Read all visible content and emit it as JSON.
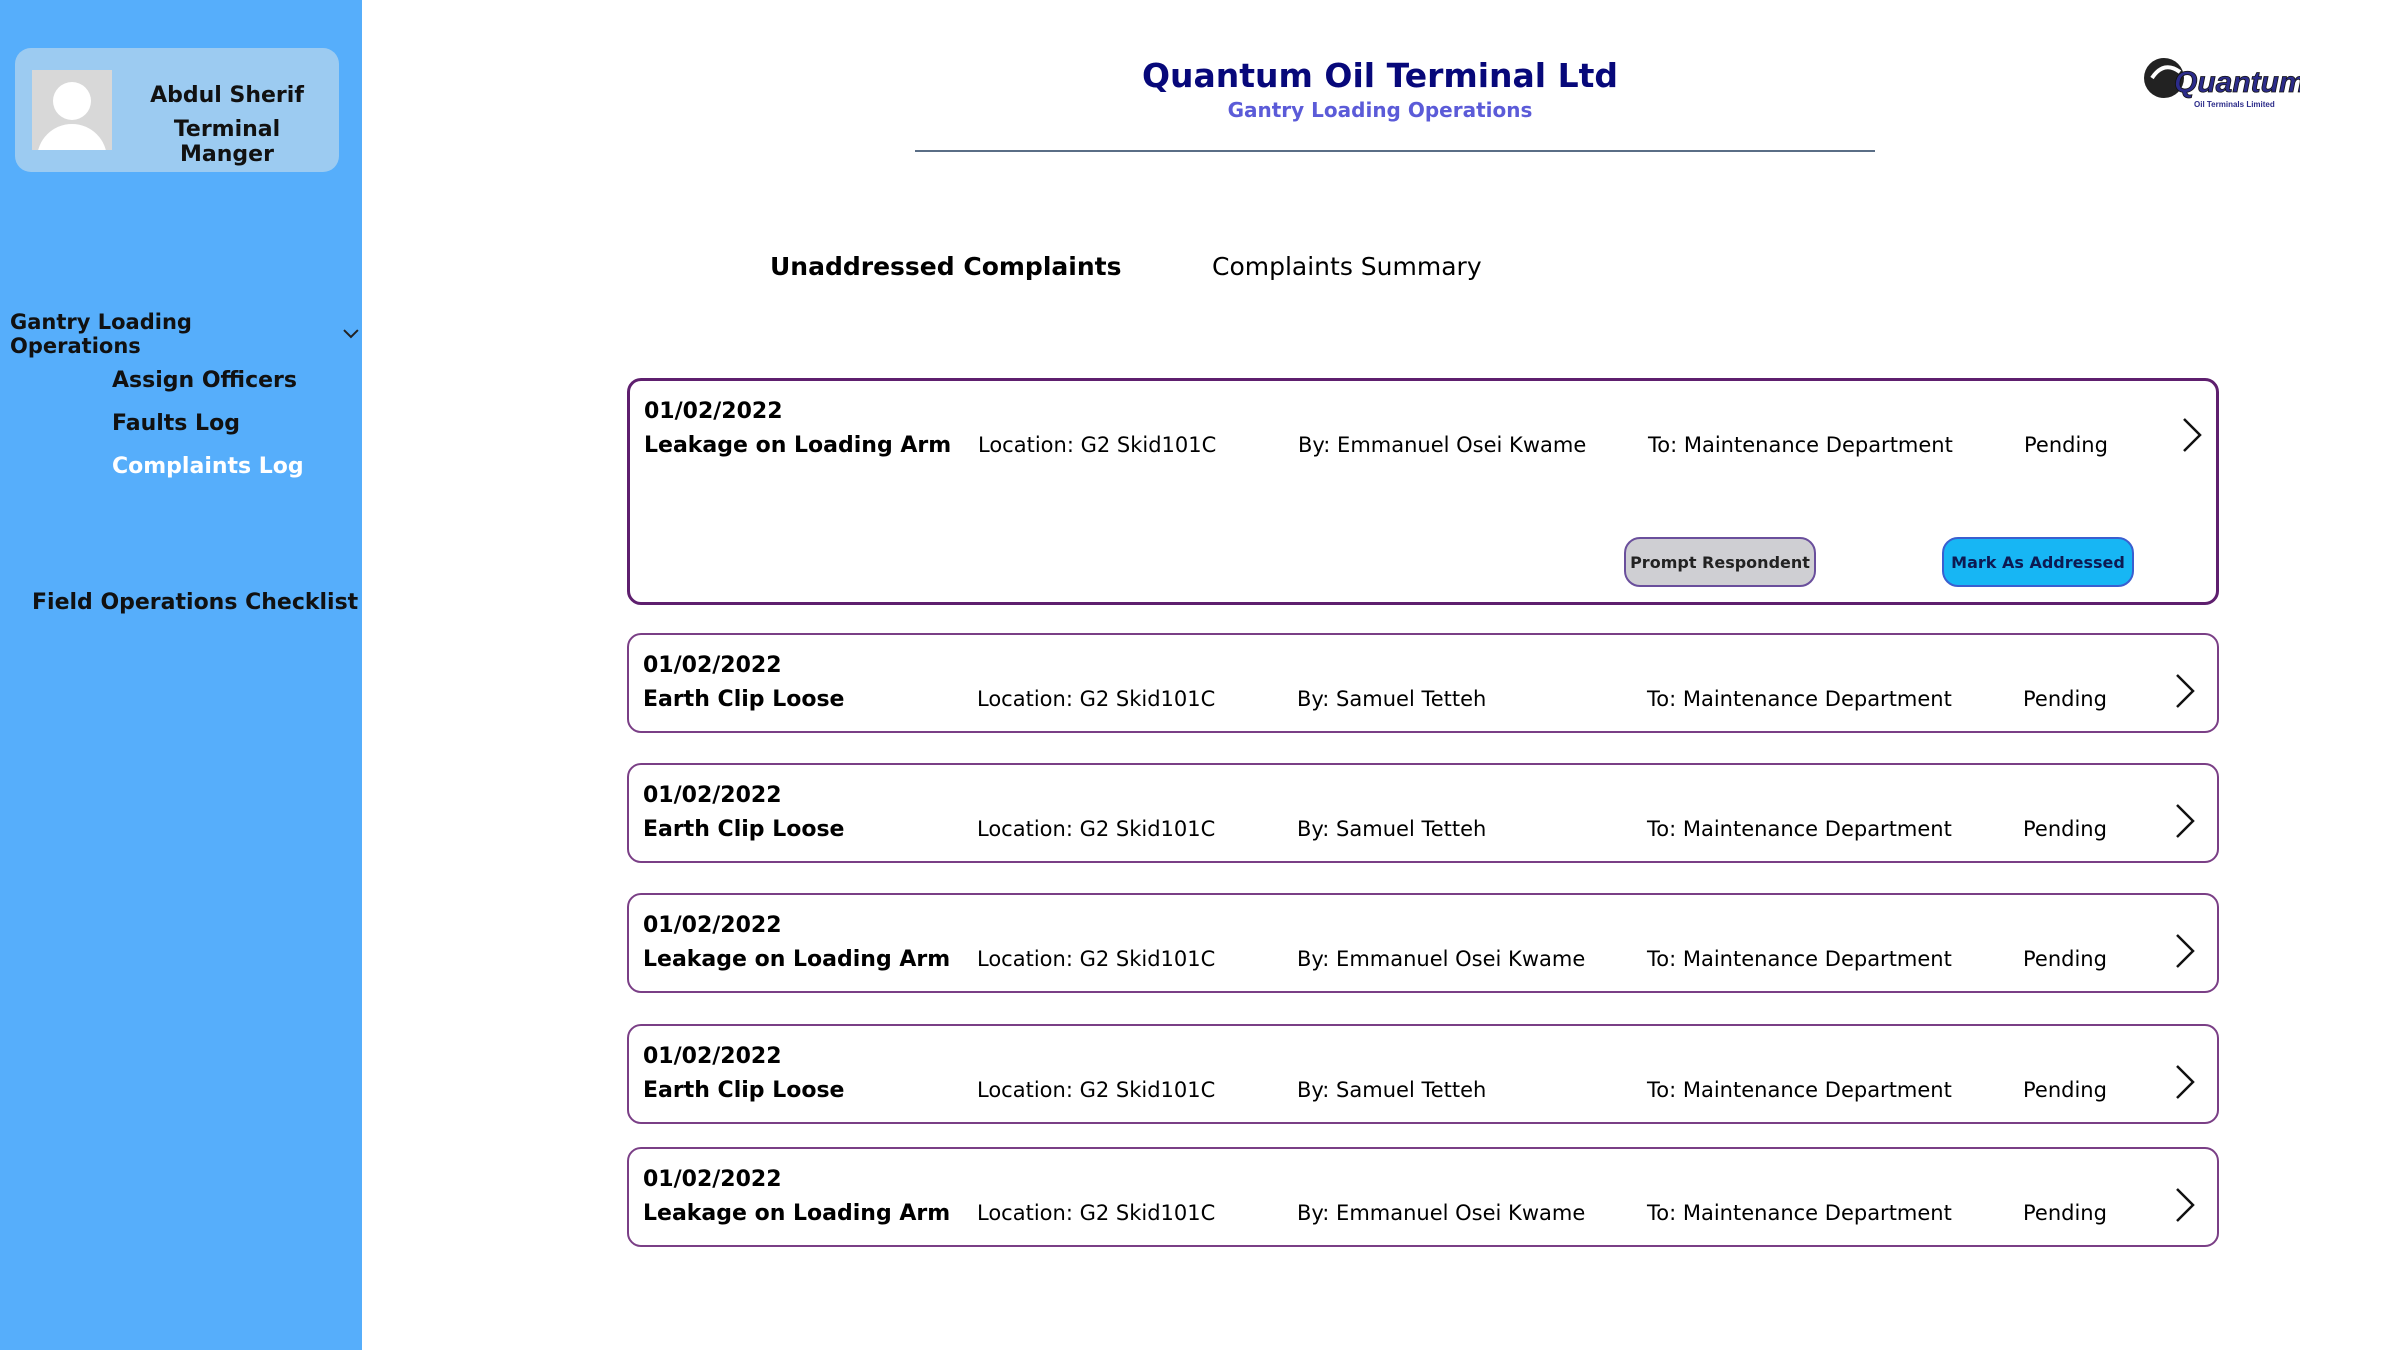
{
  "user": {
    "name": "Abdul Sherif",
    "role": "Terminal Manger"
  },
  "sidebar": {
    "group_label": "Gantry Loading Operations",
    "items": [
      {
        "label": "Assign Officers",
        "active": false
      },
      {
        "label": "Faults Log",
        "active": false
      },
      {
        "label": "Complaints Log",
        "active": true
      }
    ],
    "field_checklist": "Field Operations Checklist"
  },
  "header": {
    "company": "Quantum Oil Terminal Ltd",
    "subtitle": "Gantry Loading Operations",
    "logo_text": "Quantum",
    "logo_subtext": "Oil Terminals Limited"
  },
  "tabs": [
    {
      "label": "Unaddressed Complaints",
      "active": true
    },
    {
      "label": "Complaints Summary",
      "active": false
    }
  ],
  "complaints": [
    {
      "date": "01/02/2022",
      "title": "Leakage on Loading Arm",
      "location": "Location: G2 Skid101C",
      "by": "By: Emmanuel Osei Kwame",
      "to": "To: Maintenance Department",
      "status": "Pending",
      "prompt_label": "Prompt Respondent",
      "mark_label": "Mark As Addressed"
    },
    {
      "date": "01/02/2022",
      "title": "Earth Clip Loose",
      "location": "Location: G2 Skid101C",
      "by": "By: Samuel Tetteh",
      "to": "To: Maintenance Department",
      "status": "Pending"
    },
    {
      "date": "01/02/2022",
      "title": "Earth Clip Loose",
      "location": "Location: G2 Skid101C",
      "by": "By: Samuel Tetteh",
      "to": "To: Maintenance Department",
      "status": "Pending"
    },
    {
      "date": "01/02/2022",
      "title": "Leakage on Loading Arm",
      "location": "Location: G2 Skid101C",
      "by": "By: Emmanuel Osei Kwame",
      "to": "To: Maintenance Department",
      "status": "Pending"
    },
    {
      "date": "01/02/2022",
      "title": "Earth Clip Loose",
      "location": "Location: G2 Skid101C",
      "by": "By: Samuel Tetteh",
      "to": "To: Maintenance Department",
      "status": "Pending"
    },
    {
      "date": "01/02/2022",
      "title": "Leakage on Loading Arm",
      "location": "Location: G2 Skid101C",
      "by": "By: Emmanuel Osei Kwame",
      "to": "To: Maintenance Department",
      "status": "Pending"
    }
  ],
  "colors": {
    "sidebar": "#56aefb",
    "title": "#07087a",
    "subtitle": "#5b5bd8",
    "card_border": "#7a3f86",
    "mark_button": "#17b6f4"
  }
}
